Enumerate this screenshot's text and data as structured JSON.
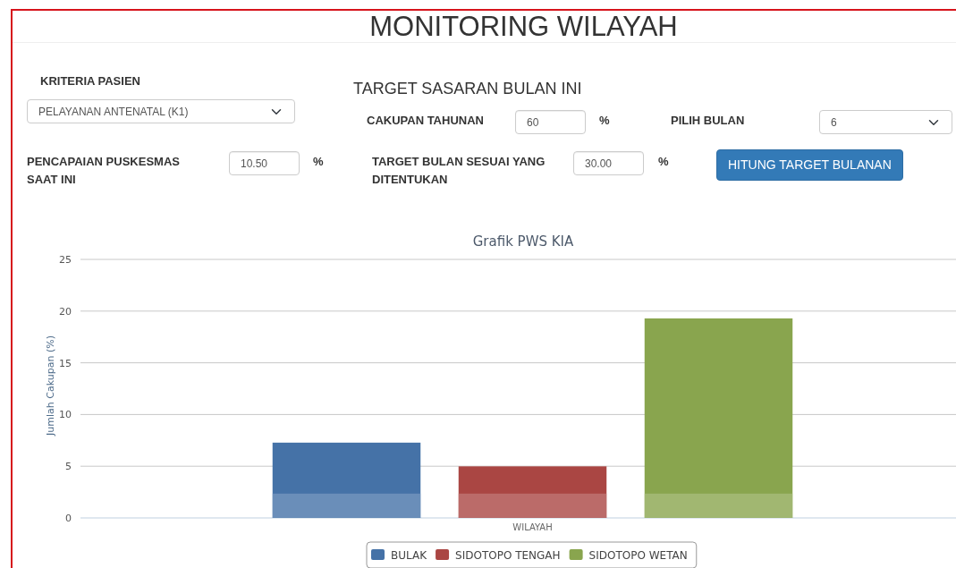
{
  "page": {
    "title": "MONITORING WILAYAH"
  },
  "patient_criteria": {
    "label": "KRITERIA PASIEN",
    "value": "PELAYANAN ANTENATAL (K1)"
  },
  "target_section": {
    "title": "TARGET SASARAN BULAN INI"
  },
  "annual_coverage": {
    "label": "CAKUPAN TAHUNAN",
    "value": "60",
    "unit": "%"
  },
  "month": {
    "label": "PILIH BULAN",
    "value": "6"
  },
  "current_achievement": {
    "label": "PENCAPAIAN PUSKESMAS SAAT INI",
    "value": "10.50",
    "unit": "%"
  },
  "monthly_target": {
    "label": "TARGET BULAN SESUAI YANG DITENTUKAN",
    "value": "30.00",
    "unit": "%"
  },
  "calculate_button": {
    "label": "HITUNG TARGET BULANAN"
  },
  "chart": {
    "chart_data": {
      "type": "bar",
      "title": "Grafik PWS KIA",
      "ylabel": "Jumlah Cakupan (%)",
      "categories": [
        "WILAYAH"
      ],
      "ylim": [
        0,
        25
      ],
      "grid": true,
      "legend": "bottom",
      "yticks": [
        0,
        5,
        10,
        15,
        20,
        25
      ],
      "series": [
        {
          "name": "BULAK",
          "color": "#4572a7",
          "values": [
            7.3
          ]
        },
        {
          "name": "SIDOTOPO TENGAH",
          "color": "#aa4643",
          "values": [
            5.0
          ]
        },
        {
          "name": "SIDOTOPO WETAN",
          "color": "#89a54e",
          "values": [
            19.3
          ]
        }
      ]
    }
  }
}
